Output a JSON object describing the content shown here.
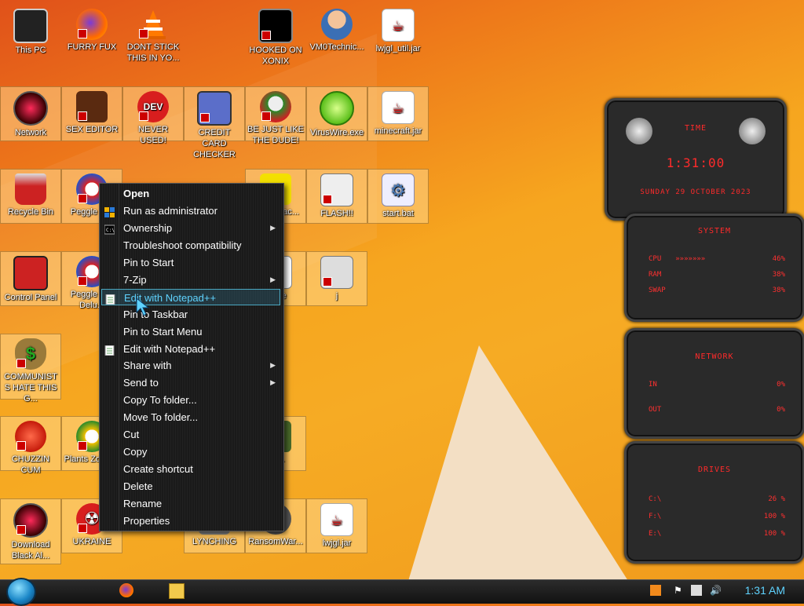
{
  "desktop": {
    "icons": [
      {
        "label": "This PC"
      },
      {
        "label": "FURRY FUX"
      },
      {
        "label": "DONT STICK THIS IN YO..."
      },
      {
        "label": "HOOKED ON XONIX"
      },
      {
        "label": "VM0Technic..."
      },
      {
        "label": "lwjgl_util.jar"
      },
      {
        "label": "Network"
      },
      {
        "label": "SEX EDITOR"
      },
      {
        "label": "NEVER USED!"
      },
      {
        "label": "CREDIT CARD CHECKER"
      },
      {
        "label": "BE JUST LIKE THE DUDE!"
      },
      {
        "label": "VirusWire.exe"
      },
      {
        "label": "minecraft.jar"
      },
      {
        "label": "Recycle Bin"
      },
      {
        "label": "Peggle D..."
      },
      {
        "label": "...you ...ac..."
      },
      {
        "label": "FLASH!!"
      },
      {
        "label": "start.bat"
      },
      {
        "label": "Control Panel"
      },
      {
        "label": "Peggle N... Delu..."
      },
      {
        "label": "...ode"
      },
      {
        "label": "j"
      },
      {
        "label": "COMMUNISTS HATE THIS G..."
      },
      {
        "label": "CHUZZIN CUM"
      },
      {
        "label": "Plants Zomb..."
      },
      {
        "label": "...F..."
      },
      {
        "label": "Download Black Al..."
      },
      {
        "label": "UKRAINE"
      },
      {
        "label": "LYNCHING"
      },
      {
        "label": "RansomWar..."
      },
      {
        "label": "lwjgl.jar"
      }
    ]
  },
  "context_menu": {
    "items": [
      {
        "label": "Open",
        "bold": true
      },
      {
        "label": "Run as administrator",
        "icon": "shield-icon"
      },
      {
        "label": "Ownership",
        "icon": "cmd-icon",
        "submenu": true
      },
      {
        "label": "Troubleshoot compatibility"
      },
      {
        "label": "Pin to Start"
      },
      {
        "label": "7-Zip",
        "submenu": true
      },
      {
        "label": "Edit with Notepad++",
        "icon": "notepad-icon",
        "highlighted": true
      },
      {
        "label": "Pin to Taskbar"
      },
      {
        "label": "Pin to Start Menu"
      },
      {
        "label": "Edit with Notepad++",
        "icon": "notepad-icon"
      },
      {
        "label": "Share with",
        "submenu": true
      },
      {
        "label": "Send to",
        "submenu": true
      },
      {
        "label": "Copy To folder..."
      },
      {
        "label": "Move To folder..."
      },
      {
        "label": "Cut"
      },
      {
        "label": "Copy"
      },
      {
        "label": "Create shortcut"
      },
      {
        "label": "Delete"
      },
      {
        "label": "Rename"
      },
      {
        "label": "Properties"
      }
    ],
    "submenu_arrow": "▶"
  },
  "gadgets": {
    "time": {
      "title": "TIME",
      "clock": "1:31:00",
      "date": "SUNDAY 29 OCTOBER 2023"
    },
    "system": {
      "title": "SYSTEM",
      "rows": [
        {
          "label": "CPU",
          "value": "46%"
        },
        {
          "label": "RAM",
          "value": "38%"
        },
        {
          "label": "SWAP",
          "value": "38%"
        }
      ]
    },
    "network": {
      "title": "NETWORK",
      "rows": [
        {
          "label": "IN",
          "value": "0%"
        },
        {
          "label": "OUT",
          "value": "0%"
        }
      ]
    },
    "drives": {
      "title": "DRIVES",
      "rows": [
        {
          "label": "C:\\",
          "value": "26 %"
        },
        {
          "label": "F:\\",
          "value": "100 %"
        },
        {
          "label": "E:\\",
          "value": "100 %"
        }
      ]
    }
  },
  "taskbar": {
    "clock": "1:31 AM",
    "pinned": [
      "firefox-icon",
      "file-explorer-icon"
    ],
    "tray": [
      "notification-icon",
      "flag-icon",
      "network-icon",
      "volume-icon"
    ]
  },
  "colors": {
    "accent": "#5fd3ff",
    "gadget_red": "#ff2a2a"
  }
}
